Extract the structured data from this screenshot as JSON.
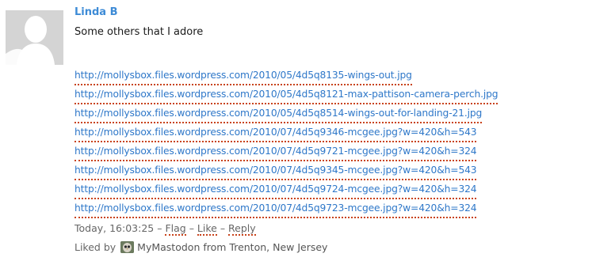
{
  "comment": {
    "author": "Linda B",
    "text": "Some others that I adore",
    "links": [
      "http://mollysbox.files.wordpress.com/2010/05/4d5q8135-wings-out.jpg",
      "http://mollysbox.files.wordpress.com/2010/05/4d5q8121-max-pattison-camera-perch.jpg",
      "http://mollysbox.files.wordpress.com/2010/05/4d5q8514-wings-out-for-landing-21.jpg",
      "http://mollysbox.files.wordpress.com/2010/07/4d5q9346-mcgee.jpg?w=420&h=543",
      "http://mollysbox.files.wordpress.com/2010/07/4d5q9721-mcgee.jpg?w=420&h=324",
      "http://mollysbox.files.wordpress.com/2010/07/4d5q9345-mcgee.jpg?w=420&h=543",
      "http://mollysbox.files.wordpress.com/2010/07/4d5q9724-mcgee.jpg?w=420&h=324",
      "http://mollysbox.files.wordpress.com/2010/07/4d5q9723-mcgee.jpg?w=420&h=324"
    ],
    "timestamp": "Today, 16:03:25",
    "separator": " – ",
    "actions": {
      "flag": "Flag",
      "like": "Like",
      "reply": "Reply"
    },
    "liked_by_prefix": "Liked by",
    "liker_name": "MyMastodon from Trenton, New Jersey"
  },
  "colors": {
    "author": "#3d8bd6",
    "link": "#2f78c9",
    "underline": "#c8421a",
    "meta_text": "#666666"
  },
  "icons": {
    "avatar": "default-user-silhouette-icon",
    "liker_avatar": "owl-photo-icon"
  }
}
